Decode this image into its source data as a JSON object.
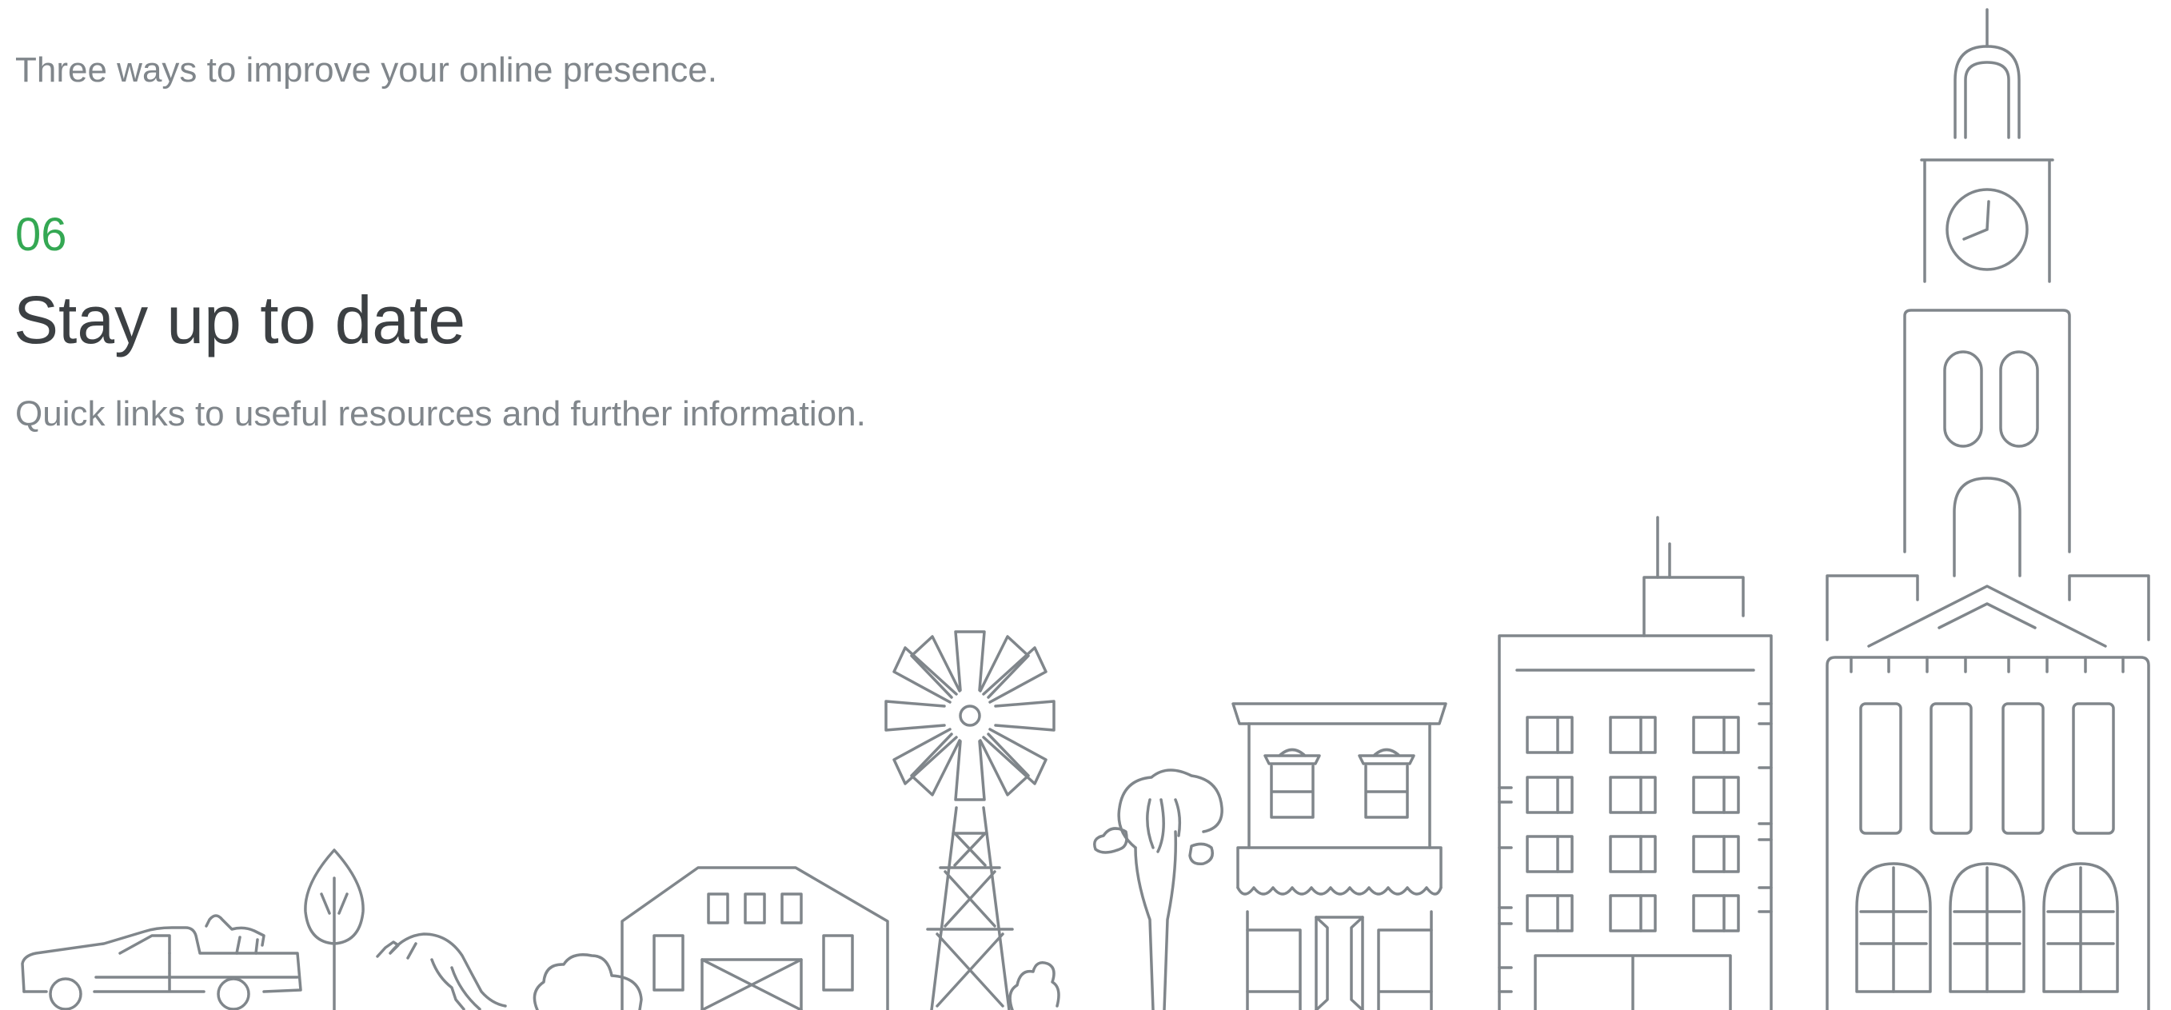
{
  "intro": {
    "text": "Three ways to improve your online presence."
  },
  "section": {
    "number": "06",
    "title": "Stay up to date",
    "description": "Quick links to useful resources and further information."
  },
  "illustration": {
    "stroke_color": "#80868b"
  },
  "colors": {
    "accent": "#34a853",
    "heading": "#3c4043",
    "body_text": "#80868b",
    "background": "#ffffff"
  }
}
